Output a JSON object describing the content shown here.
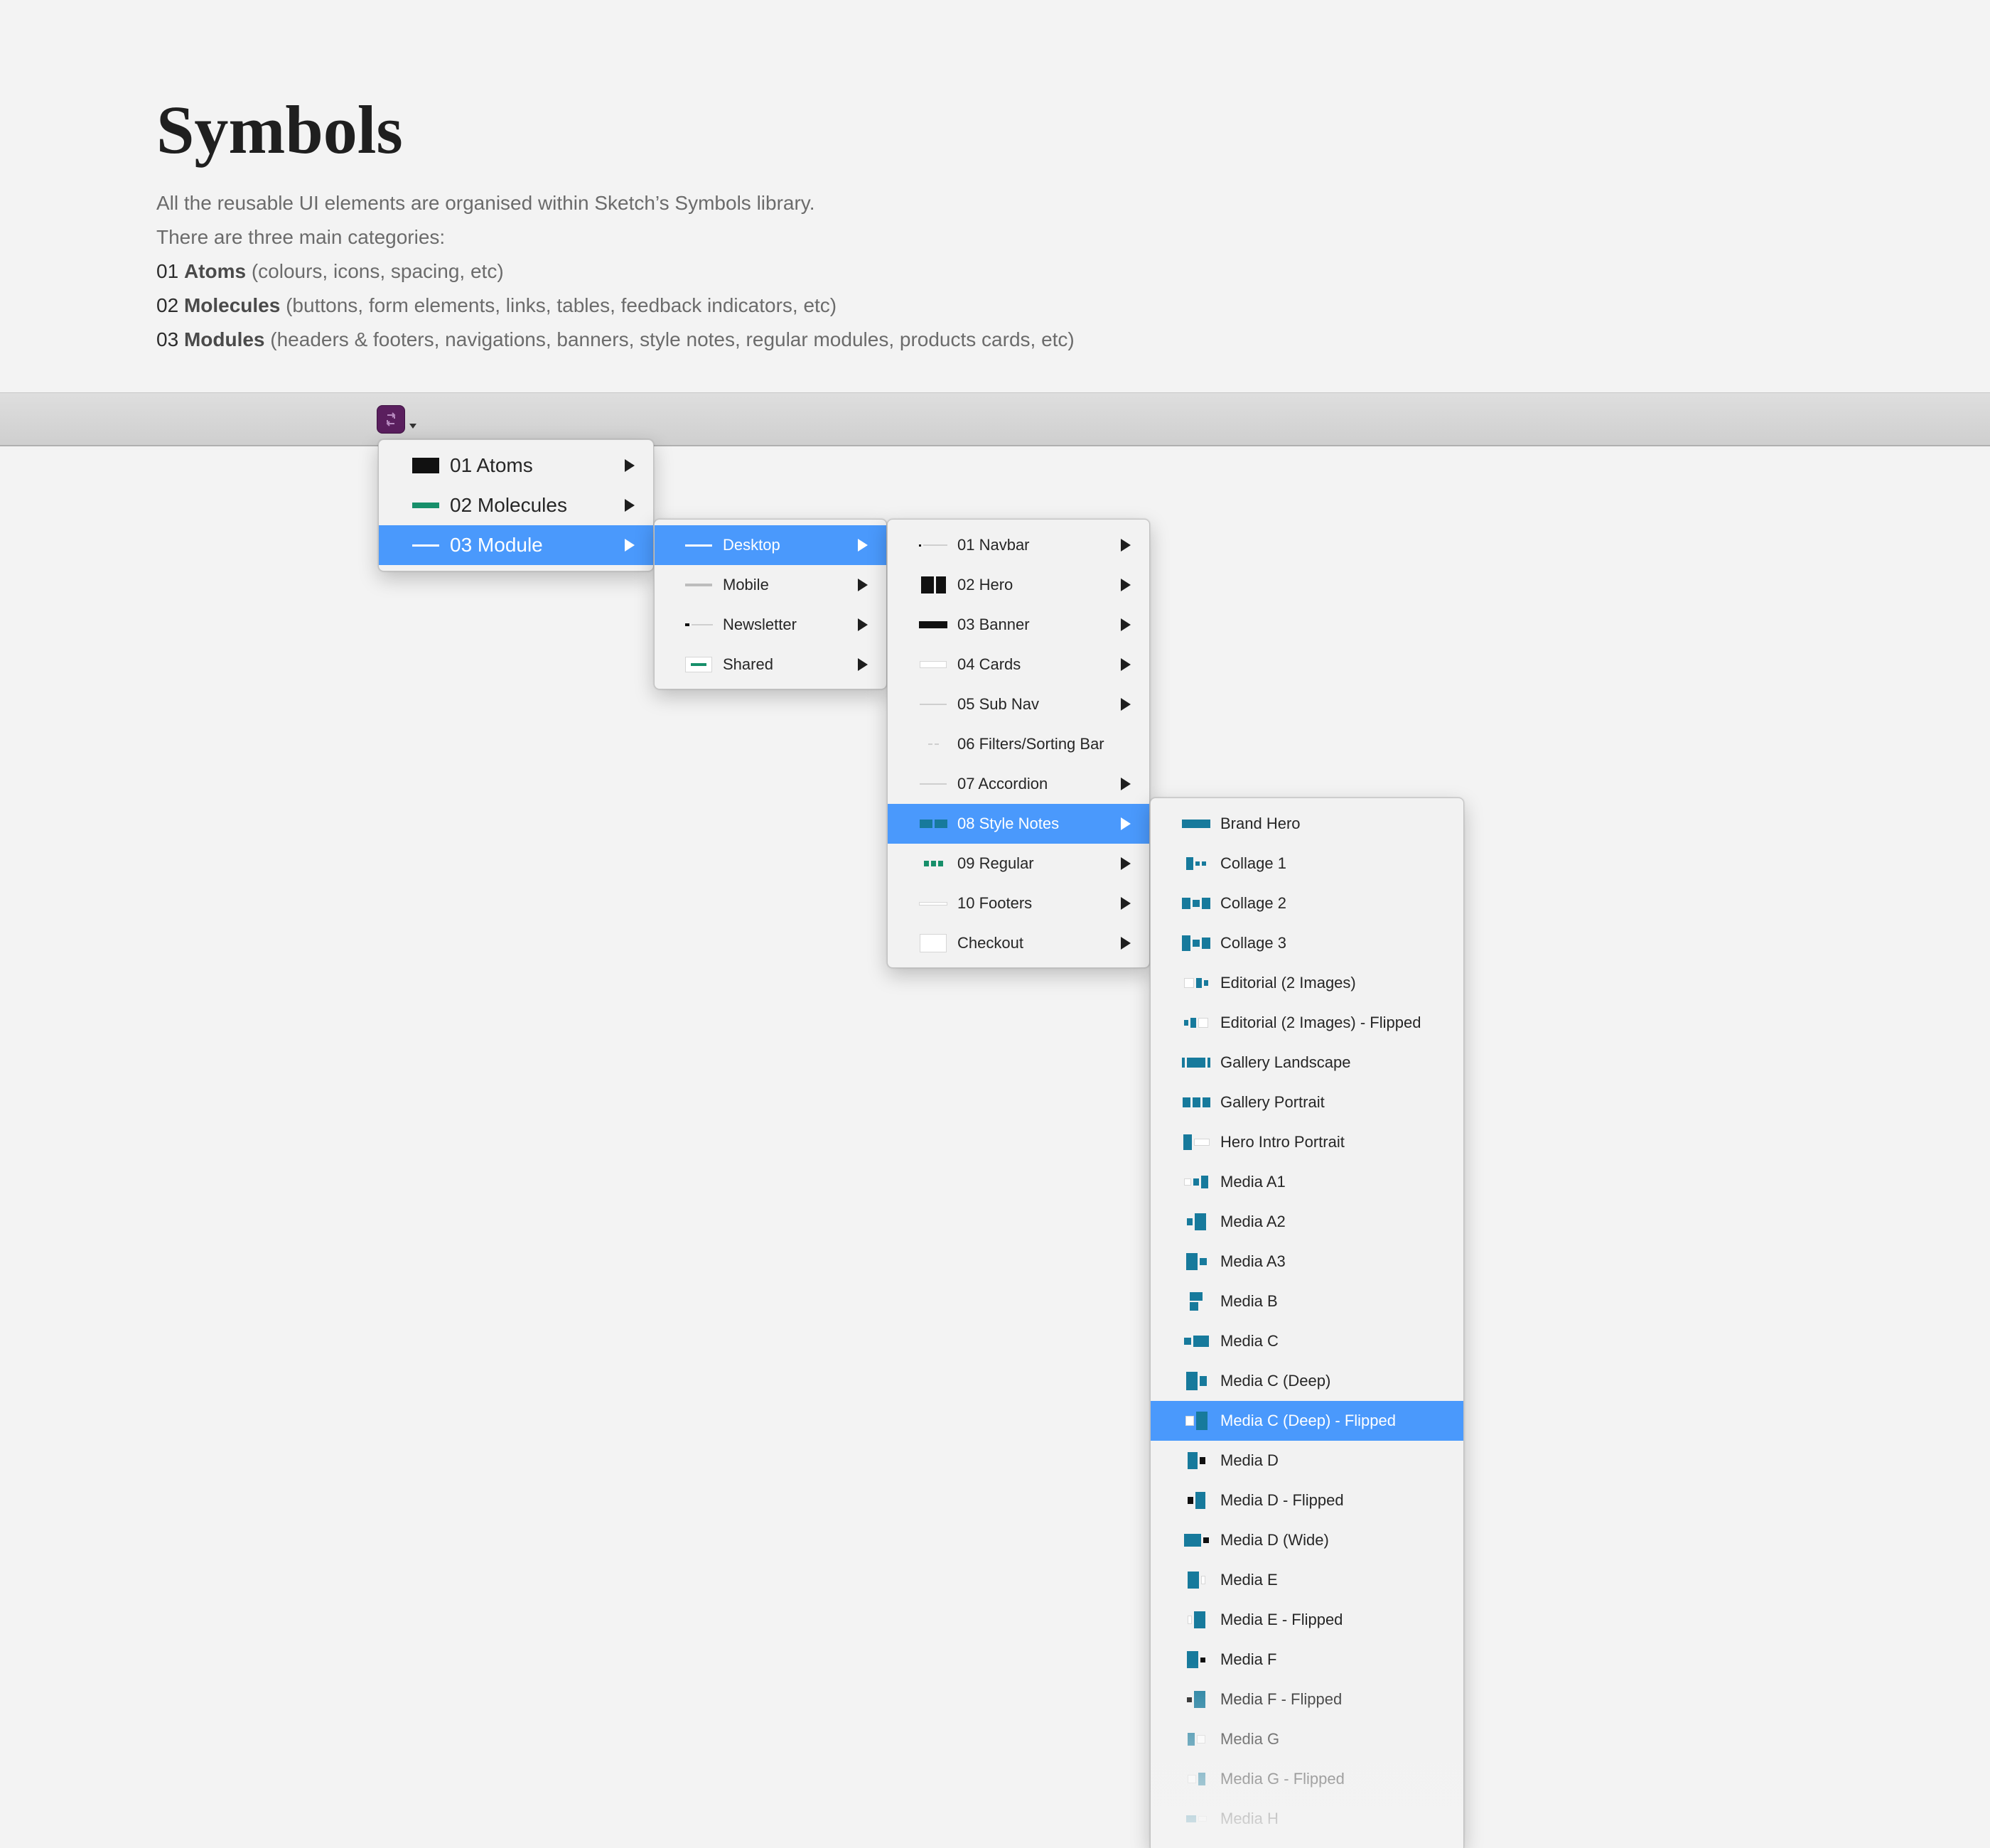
{
  "header": {
    "title": "Symbols",
    "intro_line1": "All the reusable UI elements are organised within Sketch’s Symbols library.",
    "intro_line2": "There are three main categories:",
    "categories": [
      {
        "num": "01",
        "name": "Atoms",
        "desc": "(colours, icons, spacing, etc)"
      },
      {
        "num": "02",
        "name": "Molecules",
        "desc": "(buttons, form elements, links, tables, feedback indicators, etc)"
      },
      {
        "num": "03",
        "name": "Modules",
        "desc": "(headers & footers, navigations, banners, style notes, regular modules, products cards, etc)"
      }
    ]
  },
  "colors": {
    "highlight": "#4a99fc",
    "menu_bg": "#f2f2f2",
    "thumb_blue": "#177a9c",
    "insert_button": "#5a1f5e"
  },
  "menus": {
    "level1": [
      {
        "label": "01 Atoms",
        "icon": "atoms-thumb-icon"
      },
      {
        "label": "02 Molecules",
        "icon": "molecules-thumb-icon"
      },
      {
        "label": "03 Module",
        "icon": "module-thumb-icon",
        "selected": true
      }
    ],
    "level2": [
      {
        "label": "Desktop",
        "selected": true
      },
      {
        "label": "Mobile"
      },
      {
        "label": "Newsletter"
      },
      {
        "label": "Shared"
      }
    ],
    "level3": [
      {
        "label": "01 Navbar"
      },
      {
        "label": "02 Hero"
      },
      {
        "label": "03 Banner"
      },
      {
        "label": "04 Cards"
      },
      {
        "label": "05 Sub Nav"
      },
      {
        "label": "06 Filters/Sorting Bar"
      },
      {
        "label": "07 Accordion"
      },
      {
        "label": "08 Style Notes",
        "selected": true
      },
      {
        "label": "09 Regular"
      },
      {
        "label": "10 Footers"
      },
      {
        "label": "Checkout"
      }
    ],
    "level4": [
      {
        "label": "Brand Hero"
      },
      {
        "label": "Collage 1"
      },
      {
        "label": "Collage 2"
      },
      {
        "label": "Collage 3"
      },
      {
        "label": "Editorial (2 Images)"
      },
      {
        "label": "Editorial (2 Images) - Flipped"
      },
      {
        "label": "Gallery Landscape"
      },
      {
        "label": "Gallery Portrait"
      },
      {
        "label": "Hero Intro Portrait"
      },
      {
        "label": "Media A1"
      },
      {
        "label": "Media A2"
      },
      {
        "label": "Media A3"
      },
      {
        "label": "Media B"
      },
      {
        "label": "Media C"
      },
      {
        "label": "Media C (Deep)"
      },
      {
        "label": "Media C (Deep) - Flipped",
        "selected": true
      },
      {
        "label": "Media D"
      },
      {
        "label": "Media D - Flipped"
      },
      {
        "label": "Media D (Wide)"
      },
      {
        "label": "Media E"
      },
      {
        "label": "Media E - Flipped"
      },
      {
        "label": "Media F"
      },
      {
        "label": "Media F - Flipped"
      },
      {
        "label": "Media G"
      },
      {
        "label": "Media G - Flipped"
      },
      {
        "label": "Media H"
      }
    ]
  }
}
